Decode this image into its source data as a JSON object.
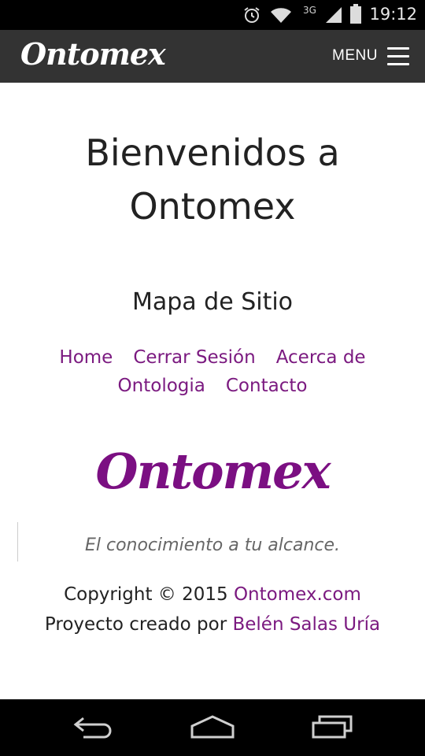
{
  "status_bar": {
    "time": "19:12",
    "network": "3G",
    "icons": [
      "alarm-icon",
      "wifi-icon",
      "signal-icon",
      "battery-icon"
    ]
  },
  "navbar": {
    "brand": "Ontomex",
    "menu_label": "MENU"
  },
  "main": {
    "welcome_line1": "Bienvenidos a",
    "welcome_line2": "Ontomex",
    "sitemap_title": "Mapa de Sitio",
    "sitemap_links": [
      "Home",
      "Cerrar Sesión",
      "Acerca de",
      "Ontologia",
      "Contacto"
    ]
  },
  "footer": {
    "logo": "Ontomex",
    "tagline": "El conocimiento a tu alcance.",
    "copyright_prefix": "Copyright © 2015 ",
    "copyright_link": "Ontomex.com",
    "project_prefix": "Proyecto creado por ",
    "project_author": "Belén Salas Uría"
  },
  "colors": {
    "accent": "#7b1a80",
    "navbar": "#333333",
    "text": "#222222"
  },
  "system_nav": [
    "back-icon",
    "home-icon",
    "recents-icon"
  ]
}
